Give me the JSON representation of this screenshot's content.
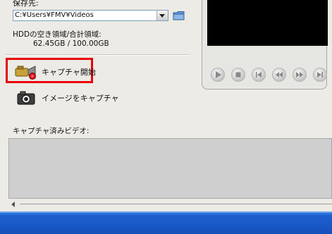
{
  "save": {
    "label": "保存先:",
    "path_value": "C:¥Users¥FMV¥Videos"
  },
  "hdd": {
    "label": "HDDの空き領域/合計領域:",
    "value": "62.45GB / 100.00GB"
  },
  "actions": {
    "capture_start_label": "キャプチャ開始",
    "image_capture_label": "イメージをキャプチャ"
  },
  "captured": {
    "label": "キャプチャ済みビデオ:"
  },
  "player_controls": [
    "play",
    "stop",
    "prev",
    "rewind",
    "fast-forward",
    "next"
  ],
  "colors": {
    "highlight": "#e8000b",
    "taskbar": "#1c5ecf"
  }
}
